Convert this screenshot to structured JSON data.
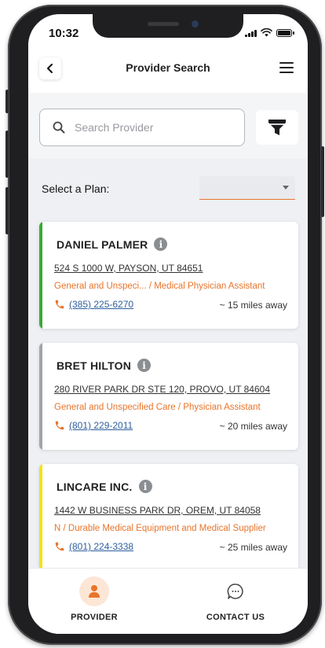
{
  "status_bar": {
    "time": "10:32"
  },
  "header": {
    "title": "Provider Search"
  },
  "search": {
    "placeholder": "Search Provider",
    "value": ""
  },
  "plan": {
    "label": "Select a Plan:",
    "selected": ""
  },
  "colors": {
    "accent_orange": "#e8742a",
    "link_blue": "#2f5f9e",
    "card_green": "#3aaa35",
    "card_gray": "#a0a3a8",
    "card_yellow": "#f2e21a"
  },
  "providers": [
    {
      "name": "DANIEL PALMER",
      "address": "524 S 1000 W, PAYSON, UT 84651",
      "specialty": "General and Unspeci... / Medical Physician Assistant",
      "phone": "(385) 225-6270",
      "distance": "~ 15 miles away",
      "accent": "#3aaa35"
    },
    {
      "name": "BRET HILTON",
      "address": "280 RIVER PARK DR STE 120, PROVO, UT 84604",
      "specialty": "General and Unspecified Care / Physician Assistant",
      "phone": "(801) 229-2011",
      "distance": "~ 20 miles away",
      "accent": "#a0a3a8"
    },
    {
      "name": "LINCARE INC.",
      "address": "1442 W BUSINESS PARK DR, OREM, UT 84058",
      "specialty": "N / Durable Medical Equipment and Medical Supplier",
      "phone": "(801) 224-3338",
      "distance": "~ 25 miles away",
      "accent": "#f2e21a"
    }
  ],
  "nav": {
    "provider_label": "PROVIDER",
    "provider_icon": "person-icon",
    "contact_label": "CONTACT US",
    "contact_icon": "chat-bubble-icon"
  }
}
